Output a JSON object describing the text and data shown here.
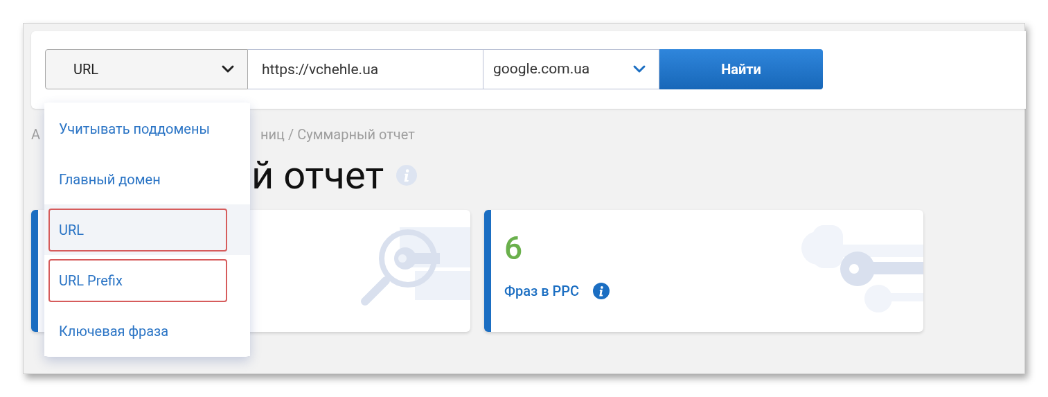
{
  "search_bar": {
    "mode_select": {
      "value": "URL"
    },
    "url_field": {
      "value": "https://vchehle.ua"
    },
    "engine_select": {
      "value": "google.com.ua"
    },
    "search_button": {
      "label": "Найти"
    }
  },
  "mode_menu": {
    "items": [
      {
        "label": "Учитывать поддомены",
        "selected": false,
        "outlined": false
      },
      {
        "label": "Главный домен",
        "selected": false,
        "outlined": false
      },
      {
        "label": "URL",
        "selected": true,
        "outlined": true
      },
      {
        "label": "URL Prefix",
        "selected": false,
        "outlined": true
      },
      {
        "label": "Ключевая фраза",
        "selected": false,
        "outlined": false
      }
    ]
  },
  "breadcrumb": {
    "left_fragment": "А",
    "right_fragment": "ниц / Суммарный отчет"
  },
  "page_title": {
    "right_fragment": "й отчет"
  },
  "cards": [
    {
      "kind": "search"
    },
    {
      "kind": "keys",
      "value": "6",
      "label": "Фраз в PPC"
    }
  ]
}
